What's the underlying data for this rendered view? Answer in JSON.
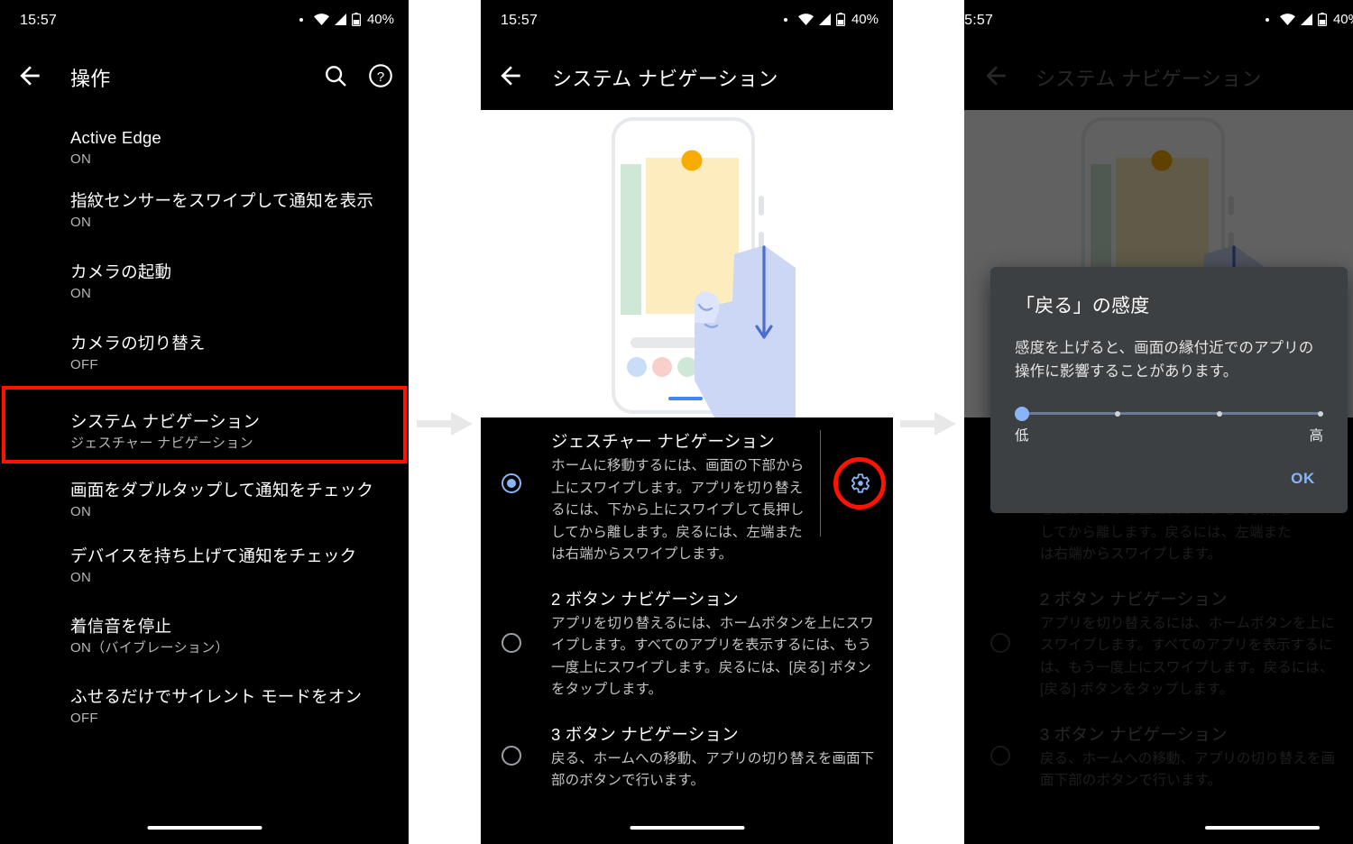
{
  "status_bar": {
    "time": "15:57",
    "battery_percent": "40%",
    "icons": [
      "dot-indicator-icon",
      "wifi-icon",
      "cellular-signal-icon",
      "battery-icon"
    ]
  },
  "colors": {
    "accent_blue": "#8ab4f8",
    "highlight_red": "#ff1200",
    "panel_bg": "#000000",
    "dialog_bg": "#3c4043",
    "secondary_text": "#b6b6b6"
  },
  "panel1": {
    "app_bar": {
      "title": "操作",
      "back_label": "戻る",
      "search_label": "検索",
      "help_label": "ヘルプ"
    },
    "items": [
      {
        "title": "Active Edge",
        "subtitle": "ON"
      },
      {
        "title": "指紋センサーをスワイプして通知を表示",
        "subtitle": "ON"
      },
      {
        "title": "カメラの起動",
        "subtitle": "ON"
      },
      {
        "title": "カメラの切り替え",
        "subtitle": "OFF"
      },
      {
        "title": "システム ナビゲーション",
        "subtitle": "ジェスチャー ナビゲーション",
        "highlighted": true
      },
      {
        "title": "画面をダブルタップして通知をチェック",
        "subtitle": "ON"
      },
      {
        "title": "デバイスを持ち上げて通知をチェック",
        "subtitle": "ON"
      },
      {
        "title": "着信音を停止",
        "subtitle": "ON（バイブレーション）"
      },
      {
        "title": "ふせるだけでサイレント モードをオン",
        "subtitle": "OFF"
      }
    ]
  },
  "panel2": {
    "app_bar": {
      "title": "システム ナビゲーション",
      "back_label": "戻る"
    },
    "illustration_name": "gesture-navigation-illustration",
    "options": [
      {
        "title": "ジェスチャー ナビゲーション",
        "description": "ホームに移動するには、画面の下部から上にスワイプします。アプリを切り替えるには、下から上にスワイプして長押ししてから離します。戻るには、左端または右端からスワイプします。",
        "selected": true,
        "has_settings_gear": true
      },
      {
        "title": "2 ボタン ナビゲーション",
        "description": "アプリを切り替えるには、ホームボタンを上にスワイプします。すべてのアプリを表示するには、もう一度上にスワイプします。戻るには、[戻る] ボタンをタップします。",
        "selected": false,
        "has_settings_gear": false
      },
      {
        "title": "3 ボタン ナビゲーション",
        "description": "戻る、ホームへの移動、アプリの切り替えを画面下部のボタンで行います。",
        "selected": false,
        "has_settings_gear": false
      }
    ]
  },
  "panel3": {
    "app_bar": {
      "title": "システム ナビゲーション",
      "back_label": "戻る"
    },
    "dialog": {
      "title": "「戻る」の感度",
      "body": "感度を上げると、画面の縁付近でのアプリの操作に影響することがあります。",
      "slider": {
        "low_label": "低",
        "high_label": "高",
        "value": 0,
        "steps": 4
      },
      "ok_label": "OK"
    }
  },
  "flow": {
    "arrow_name": "flow-arrow-right",
    "count": 2
  }
}
